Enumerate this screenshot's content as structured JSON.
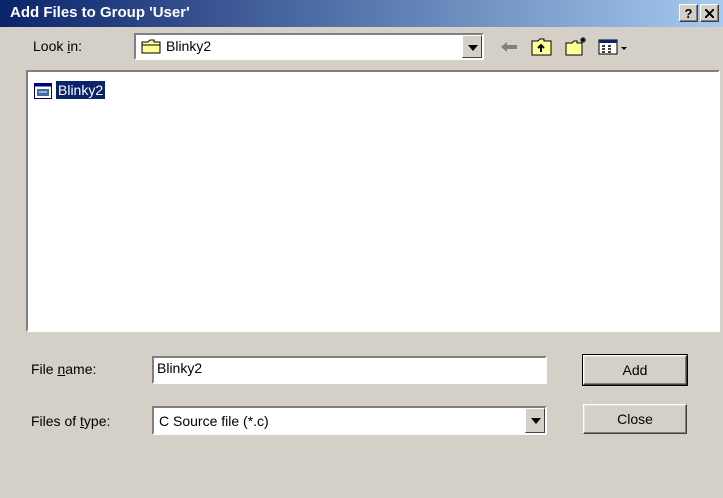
{
  "dialog": {
    "title": "Add Files to Group 'User'",
    "help_label": "?",
    "close_label": "×"
  },
  "lookin": {
    "label_pre": "Look ",
    "label_accel": "i",
    "label_post": "n:",
    "value": "Blinky2",
    "icon": "folder-icon"
  },
  "toolbar": {
    "icons": [
      "back-arrow-icon",
      "up-folder-icon",
      "new-folder-icon",
      "view-menu-icon"
    ]
  },
  "files": [
    {
      "name": "Blinky2",
      "icon": "project-file-icon",
      "selected": true
    }
  ],
  "filename": {
    "label_pre": "File ",
    "label_accel": "n",
    "label_post": "ame:",
    "value": "Blinky2"
  },
  "filetype": {
    "label_pre": "Files of ",
    "label_accel": "t",
    "label_post": "ype:",
    "value": "C Source file (*.c)"
  },
  "buttons": {
    "add": "Add",
    "close": "Close"
  },
  "colors": {
    "title_start": "#0a246a",
    "title_end": "#a6caf0",
    "face": "#d4d0c8",
    "selection": "#0a246a"
  }
}
